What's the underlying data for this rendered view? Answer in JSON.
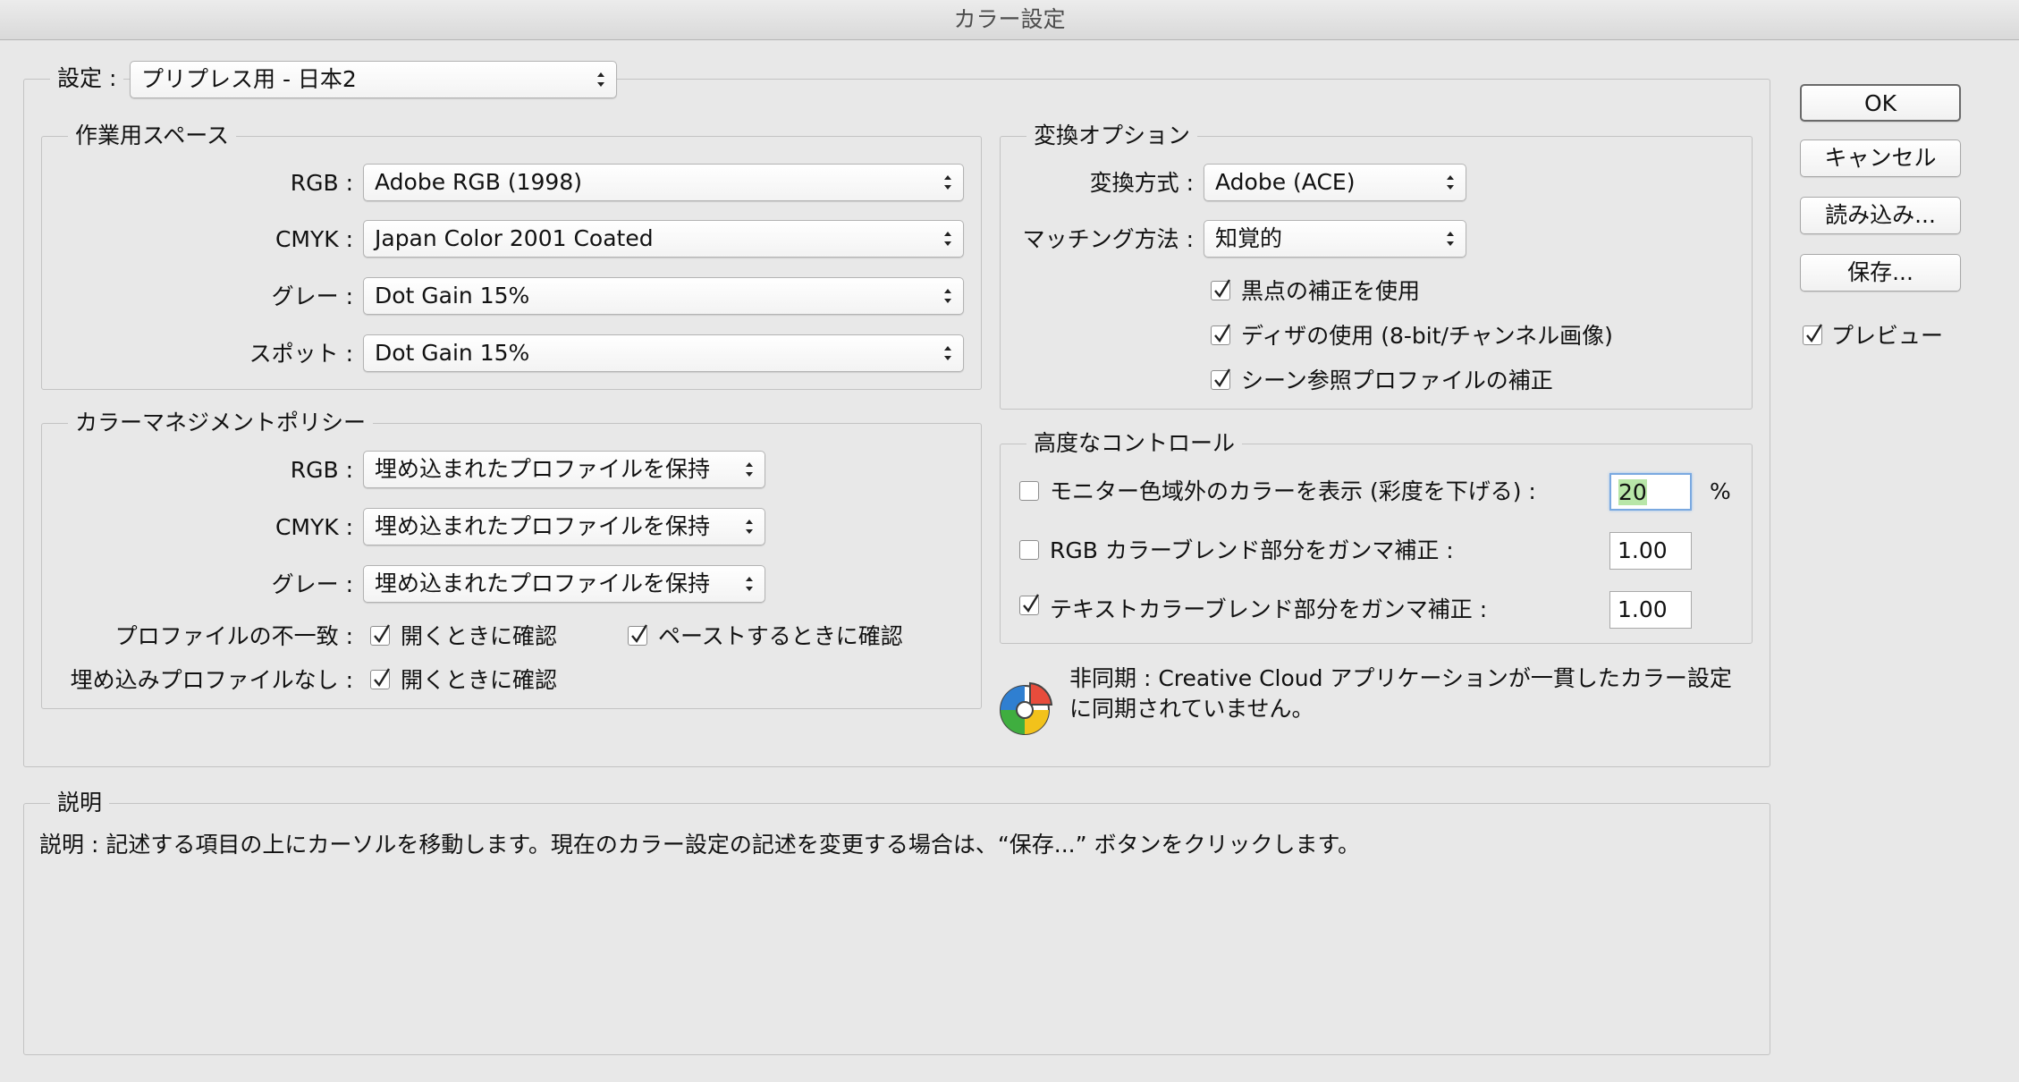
{
  "window": {
    "title": "カラー設定"
  },
  "settings": {
    "label": "設定 :",
    "value": "プリプレス用 - 日本2"
  },
  "working_spaces": {
    "title": "作業用スペース",
    "rows": [
      {
        "label": "RGB :",
        "value": "Adobe RGB (1998)"
      },
      {
        "label": "CMYK :",
        "value": "Japan Color 2001 Coated"
      },
      {
        "label": "グレー :",
        "value": "Dot Gain 15%"
      },
      {
        "label": "スポット :",
        "value": "Dot Gain 15%"
      }
    ]
  },
  "policies": {
    "title": "カラーマネジメントポリシー",
    "rows": [
      {
        "label": "RGB :",
        "value": "埋め込まれたプロファイルを保持"
      },
      {
        "label": "CMYK :",
        "value": "埋め込まれたプロファイルを保持"
      },
      {
        "label": "グレー :",
        "value": "埋め込まれたプロファイルを保持"
      }
    ],
    "mismatch_label": "プロファイルの不一致 :",
    "mismatch_open": {
      "label": "開くときに確認",
      "checked": true
    },
    "mismatch_paste": {
      "label": "ペーストするときに確認",
      "checked": true
    },
    "missing_label": "埋め込みプロファイルなし :",
    "missing_open": {
      "label": "開くときに確認",
      "checked": true
    }
  },
  "conversion": {
    "title": "変換オプション",
    "engine_label": "変換方式 :",
    "engine_value": "Adobe (ACE)",
    "intent_label": "マッチング方法 :",
    "intent_value": "知覚的",
    "bpc": {
      "label": "黒点の補正を使用",
      "checked": true
    },
    "dither": {
      "label": "ディザの使用 (8-bit/チャンネル画像)",
      "checked": true
    },
    "scene": {
      "label": "シーン参照プロファイルの補正",
      "checked": true
    }
  },
  "advanced": {
    "title": "高度なコントロール",
    "desaturate": {
      "label": "モニター色域外のカラーを表示 (彩度を下げる) :",
      "checked": false,
      "value": "20",
      "unit": "%"
    },
    "rgb_blend": {
      "label": "RGB カラーブレンド部分をガンマ補正 :",
      "checked": false,
      "value": "1.00"
    },
    "text_blend": {
      "label": "テキストカラーブレンド部分をガンマ補正 :",
      "checked": true,
      "value": "1.00"
    }
  },
  "sync": {
    "line1": "非同期 : Creative Cloud アプリケーションが一貫したカラー設定",
    "line2": "に同期されていません。"
  },
  "description": {
    "title": "説明",
    "text": "説明 : 記述する項目の上にカーソルを移動します。現在のカラー設定の記述を変更する場合は、“保存...” ボタンをクリックします。"
  },
  "buttons": {
    "ok": "OK",
    "cancel": "キャンセル",
    "load": "読み込み...",
    "save": "保存..."
  },
  "preview": {
    "label": "プレビュー",
    "checked": true
  },
  "colors": {
    "focus_ring": "#7aa9e0",
    "highlight": "#b8e6a8",
    "sync_red": "#e74c3c",
    "sync_blue": "#2f7fd1",
    "sync_green": "#3fae3f",
    "sync_yellow": "#f2c21b"
  }
}
